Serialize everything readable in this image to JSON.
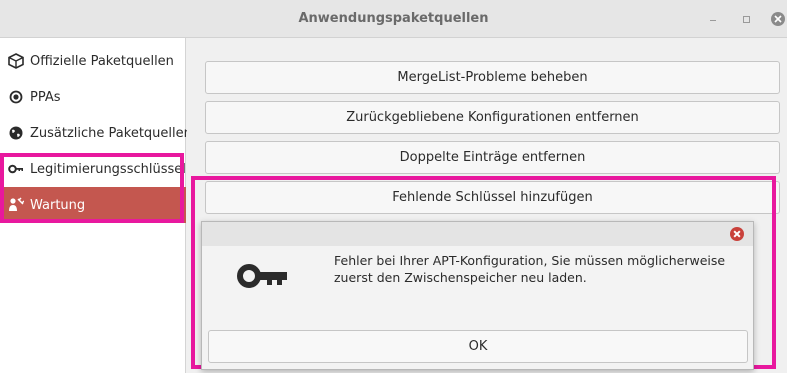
{
  "window": {
    "title": "Anwendungspaketquellen"
  },
  "sidebar": {
    "items": [
      {
        "label": "Offizielle Paketquellen",
        "icon": "package-icon"
      },
      {
        "label": "PPAs",
        "icon": "ppa-radio-icon"
      },
      {
        "label": "Zusätzliche Paketquellen",
        "icon": "globe-icon"
      },
      {
        "label": "Legitimierungsschlüssel",
        "icon": "key-icon"
      },
      {
        "label": "Wartung",
        "icon": "maintenance-icon",
        "selected": true
      }
    ]
  },
  "main": {
    "buttons": [
      {
        "label": "MergeList-Probleme beheben"
      },
      {
        "label": "Zurückgebliebene Konfigurationen entfernen"
      },
      {
        "label": "Doppelte Einträge entfernen"
      },
      {
        "label": "Fehlende Schlüssel hinzufügen"
      }
    ]
  },
  "dialog": {
    "message": "Fehler bei Ihrer APT-Konfiguration, Sie müssen möglicherweise zuerst den Zwischenspeicher neu laden.",
    "ok_label": "OK"
  },
  "colors": {
    "highlight": "#e8189e",
    "selected_item": "#c4574f",
    "close_button": "#c9413b"
  }
}
